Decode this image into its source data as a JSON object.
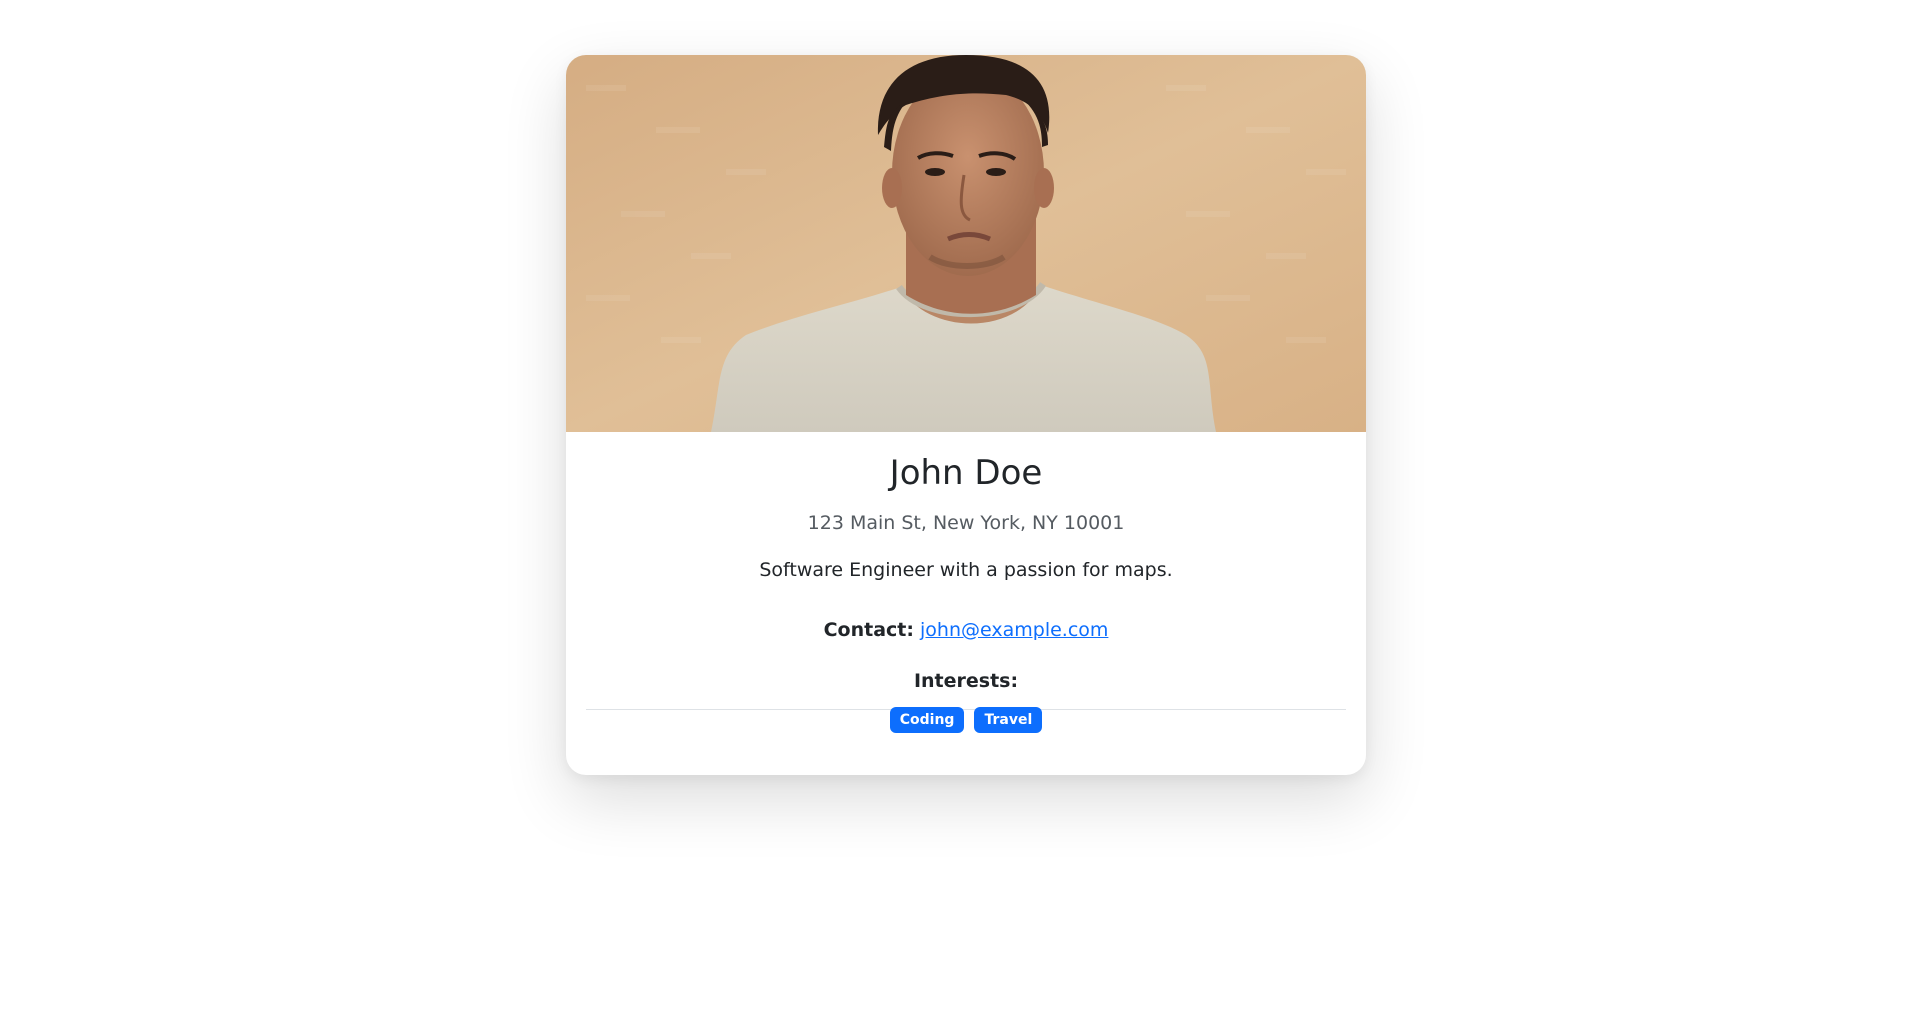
{
  "profile": {
    "name": "John Doe",
    "address": "123 Main St, New York, NY 10001",
    "bio": "Software Engineer with a passion for maps.",
    "contact_label": "Contact:",
    "contact_email": "john@example.com",
    "interests_label": "Interests:",
    "interests": [
      "Coding",
      "Travel"
    ],
    "photo_alt": "profile-photo"
  },
  "colors": {
    "accent": "#0d6efd",
    "photo_background": "#d9b58f",
    "shirt": "#d8d4c8",
    "skin": "#b98766",
    "hair": "#2a1d17"
  }
}
